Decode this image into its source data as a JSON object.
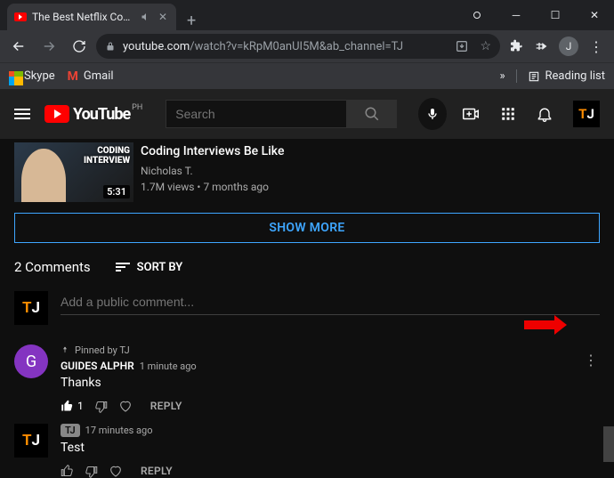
{
  "browser": {
    "tab_title": "The Best Netflix Comedies of",
    "url_host": "youtube.com",
    "url_path": "/watch?v=kRpM0anUI5M&ab_channel=TJ",
    "bookmarks": {
      "skype": "Skype",
      "gmail": "Gmail",
      "reading": "Reading list"
    },
    "avatar_letter": "J"
  },
  "mast": {
    "country": "PH",
    "search_placeholder": "Search"
  },
  "related": {
    "title": "Coding Interviews Be Like",
    "channel": "Nicholas T.",
    "views": "1.7M views",
    "age": "7 months ago",
    "duration": "5:31",
    "overlay1": "CODING",
    "overlay2": "INTERVIEW"
  },
  "showmore_label": "SHOW MORE",
  "comments": {
    "count_label": "2 Comments",
    "sort_label": "SORT BY",
    "add_placeholder": "Add a public comment..."
  },
  "c1": {
    "pinned": "Pinned by TJ",
    "author": "GUIDES ALPHR",
    "time": "1 minute ago",
    "text": "Thanks",
    "likes": "1",
    "reply": "REPLY",
    "avatar_letter": "G",
    "avatar_color": "#8434c1"
  },
  "c2": {
    "author": "TJ",
    "time": "17 minutes ago",
    "text": "Test",
    "reply": "REPLY"
  }
}
